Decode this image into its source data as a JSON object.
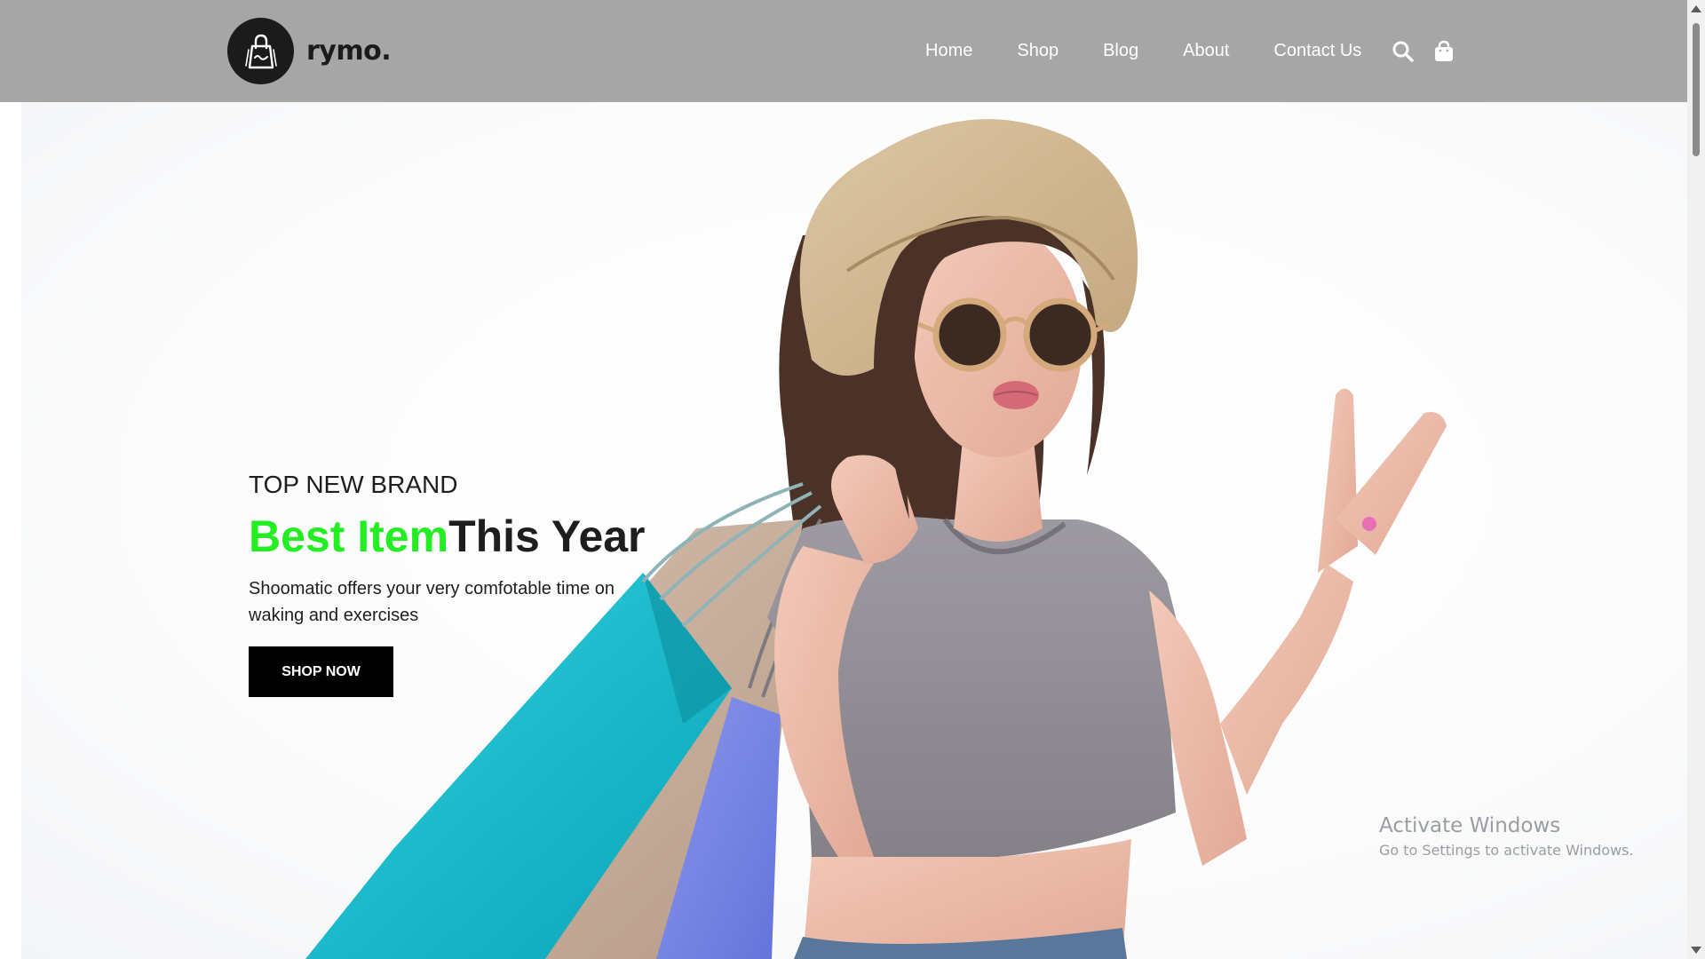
{
  "header": {
    "logo_text": "rymo.",
    "nav": [
      "Home",
      "Shop",
      "Blog",
      "About",
      "Contact Us"
    ],
    "icons": [
      "search-icon",
      "shopping-bag-icon"
    ],
    "background": "#a6a6a6"
  },
  "hero": {
    "eyebrow": "TOP NEW BRAND",
    "headline_accent": "Best Item",
    "headline_rest": "This Year",
    "description": "Shoomatic offers your very comfotable time on waking and exercises",
    "cta": "SHOP NOW",
    "accent_color": "#22ee22",
    "image": "woman-with-shopping-bags"
  },
  "watermark": {
    "title": "Activate Windows",
    "subtitle": "Go to Settings to activate Windows."
  }
}
